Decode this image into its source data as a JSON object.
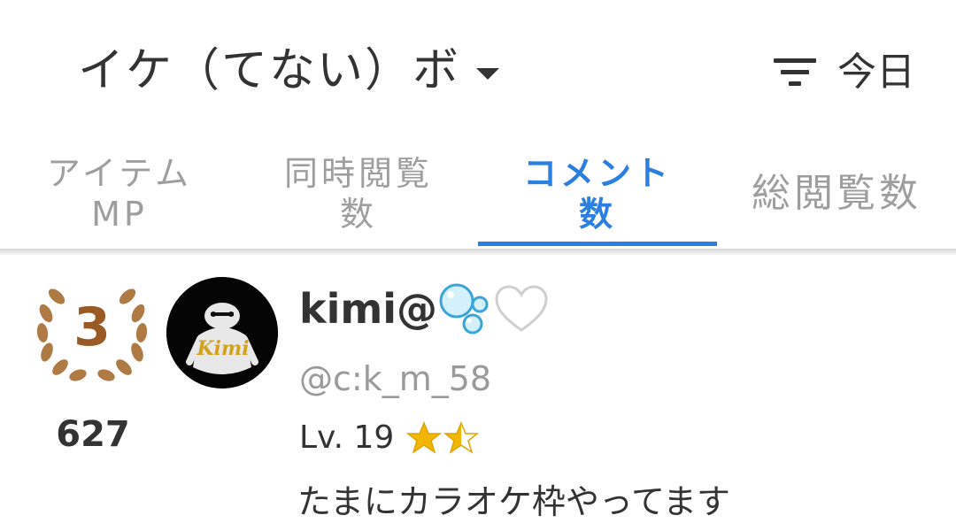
{
  "header": {
    "title": "イケ（てない）ボ",
    "dropdown_icon": "caret-down-icon",
    "filter_icon": "filter-list-icon",
    "filter_label": "今日"
  },
  "tabs": [
    {
      "line1": "アイテム",
      "line2": "MP",
      "active": false
    },
    {
      "line1": "同時閲覧",
      "line2": "数",
      "active": false
    },
    {
      "line1": "コメント",
      "line2": "数",
      "active": true
    },
    {
      "line1": "総閲覧数",
      "line2": "",
      "active": false
    }
  ],
  "colors": {
    "accent": "#2a7fe0",
    "bronze": "#9a5a24",
    "star": "#f2b705",
    "text": "#333333",
    "muted": "#9e9e9e"
  },
  "ranking": {
    "rank": "3",
    "score": "627",
    "avatar_text": "Kimi",
    "user": {
      "name": "kimi@",
      "name_emojis": [
        "bubbles-emoji",
        "white-heart-emoji"
      ],
      "id": "@c:k_m_58",
      "level": "Lv. 19",
      "stars": 1.5,
      "bio": "たまにカラオケ枠やってます"
    }
  }
}
